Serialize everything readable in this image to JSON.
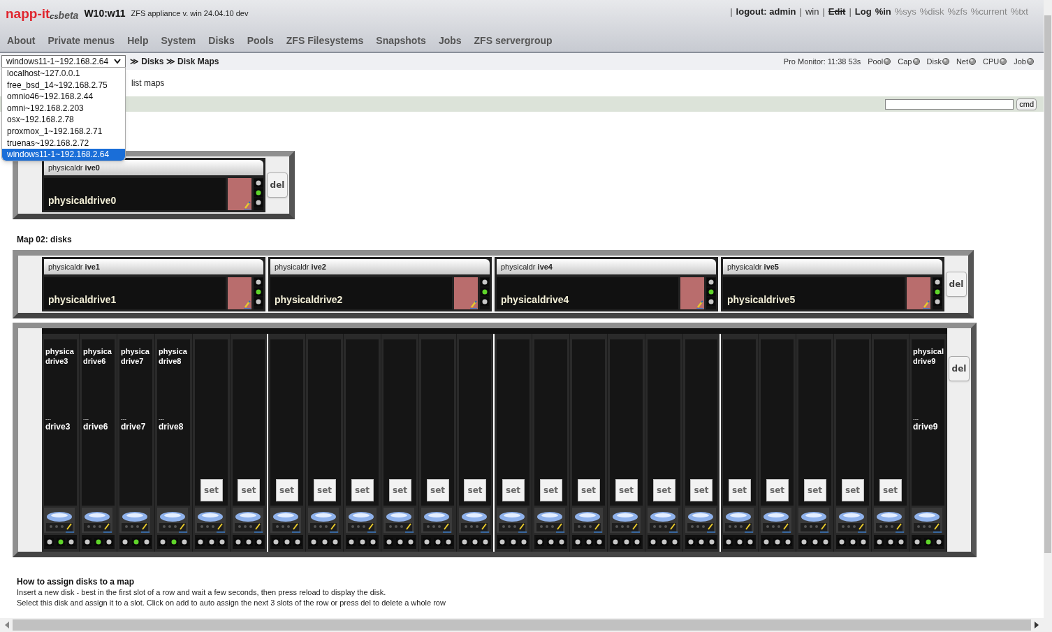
{
  "header": {
    "logo": "napp-it",
    "logo_suffix": "cs",
    "logo_beta": "beta",
    "host": "W10:w11",
    "subtitle": "ZFS appliance v. win 24.04.10 dev",
    "links": [
      {
        "kind": "sep",
        "text": "|"
      },
      {
        "kind": "bold",
        "text": "logout: admin"
      },
      {
        "kind": "sep",
        "text": "|"
      },
      {
        "kind": "normal",
        "text": "win"
      },
      {
        "kind": "sep",
        "text": "|"
      },
      {
        "kind": "struck",
        "text": "Edit"
      },
      {
        "kind": "sep",
        "text": "|"
      },
      {
        "kind": "bold",
        "text": "Log"
      },
      {
        "kind": "bold",
        "text": "%in"
      },
      {
        "kind": "muted",
        "text": "%sys"
      },
      {
        "kind": "muted",
        "text": "%disk"
      },
      {
        "kind": "muted",
        "text": "%zfs"
      },
      {
        "kind": "muted",
        "text": "%current"
      },
      {
        "kind": "muted",
        "text": "%txt"
      }
    ]
  },
  "menu": [
    "About",
    "Private menus",
    "Help",
    "System",
    "Disks",
    "Pools",
    "ZFS Filesystems",
    "Snapshots",
    "Jobs",
    "ZFS servergroup"
  ],
  "host_select": {
    "value": "windows11-1~192.168.2.64",
    "expanded": true,
    "options": [
      {
        "text": "localhost~127.0.0.1",
        "selected": false
      },
      {
        "text": "free_bsd_14~192.168.2.75",
        "selected": false
      },
      {
        "text": "omnio46~192.168.2.44",
        "selected": false
      },
      {
        "text": "omni~192.168.2.203",
        "selected": false
      },
      {
        "text": "osx~192.168.2.78",
        "selected": false
      },
      {
        "text": "proxmox_1~192.168.2.71",
        "selected": false
      },
      {
        "text": "truenas~192.168.2.72",
        "selected": false
      },
      {
        "text": "windows11-1~192.168.2.64",
        "selected": true
      }
    ]
  },
  "breadcrumb": "≫ Disks ≫ Disk Maps",
  "monitor": {
    "label": "Pro Monitor: 11:38 53s",
    "indicators": [
      "Pool",
      "Cap",
      "Disk",
      "Net",
      "CPU",
      "Job"
    ]
  },
  "submenu": "list maps",
  "cmd_button": "cmd",
  "maps": [
    {
      "rows": [
        {
          "kind": "horizontal",
          "del": "del",
          "bays": [
            {
              "tab": "physicaldr **ive0**",
              "name": "physicaldrive0",
              "active": true
            }
          ]
        }
      ]
    },
    {
      "title": "Map 02: disks",
      "rows": [
        {
          "kind": "horizontal",
          "del": "del",
          "bays": [
            {
              "tab": "physicaldr **ive1**",
              "name": "physicaldrive1",
              "active": true
            },
            {
              "tab": "physicaldr **ive2**",
              "name": "physicaldrive2",
              "active": true
            },
            {
              "tab": "physicaldr **ive4**",
              "name": "physicaldrive4",
              "active": true
            },
            {
              "tab": "physicaldr **ive5**",
              "name": "physicaldrive5",
              "active": true
            }
          ]
        },
        {
          "kind": "vertical",
          "del": "del",
          "slots": [
            {
              "kind": "disk",
              "label": [
                "physica",
                "drive3"
              ],
              "dots": "---",
              "name": "drive3",
              "active": true
            },
            {
              "kind": "disk",
              "label": [
                "physica",
                "drive6"
              ],
              "dots": "---",
              "name": "drive6",
              "active": true
            },
            {
              "kind": "disk",
              "label": [
                "physica",
                "drive7"
              ],
              "dots": "---",
              "name": "drive7",
              "active": true
            },
            {
              "kind": "disk",
              "label": [
                "physica",
                "drive8"
              ],
              "dots": "---",
              "name": "drive8",
              "active": true
            },
            {
              "kind": "empty",
              "button": "set",
              "active": false
            },
            {
              "kind": "empty",
              "button": "set",
              "active": false
            },
            {
              "kind": "empty",
              "button": "set",
              "active": false
            },
            {
              "kind": "empty",
              "button": "set",
              "active": false
            },
            {
              "kind": "empty",
              "button": "set",
              "active": false
            },
            {
              "kind": "empty",
              "button": "set",
              "active": false
            },
            {
              "kind": "empty",
              "button": "set",
              "active": false
            },
            {
              "kind": "empty",
              "button": "set",
              "active": false
            },
            {
              "kind": "empty",
              "button": "set",
              "active": false
            },
            {
              "kind": "empty",
              "button": "set",
              "active": false
            },
            {
              "kind": "empty",
              "button": "set",
              "active": false
            },
            {
              "kind": "empty",
              "button": "set",
              "active": false
            },
            {
              "kind": "empty",
              "button": "set",
              "active": false
            },
            {
              "kind": "empty",
              "button": "set",
              "active": false
            },
            {
              "kind": "empty",
              "button": "set",
              "active": false
            },
            {
              "kind": "empty",
              "button": "set",
              "active": false
            },
            {
              "kind": "empty",
              "button": "set",
              "active": false
            },
            {
              "kind": "empty",
              "button": "set",
              "active": false
            },
            {
              "kind": "empty",
              "button": "set",
              "active": false
            },
            {
              "kind": "disk",
              "label": [
                "physical",
                "drive9"
              ],
              "dots": "---",
              "name": "drive9",
              "active": true
            }
          ]
        }
      ]
    }
  ],
  "help": {
    "title": "How to assign disks to a map",
    "lines": [
      "Insert a new disk - best in the first slot of a row and wait a few seconds, then press reload to display the disk.",
      "Select this disk and assign it to a slot. Click on add to auto assign the next 3 slots of the row or press del to delete a whole row"
    ]
  }
}
